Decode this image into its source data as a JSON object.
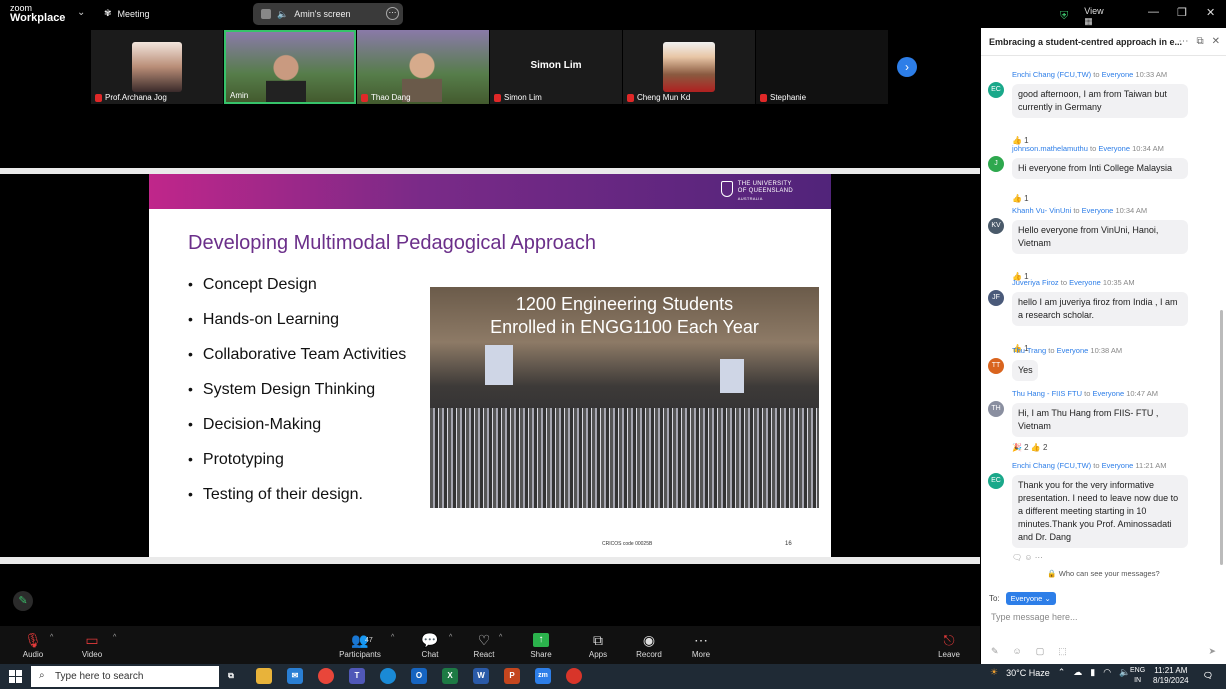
{
  "topbar": {
    "logo_line1": "zoom",
    "logo_line2": "Workplace",
    "meeting_label": "Meeting",
    "share_label": "Amin's screen",
    "view_label": "View"
  },
  "participants": [
    {
      "name": "Prof.Archana Jog",
      "type": "photo"
    },
    {
      "name": "Amin",
      "type": "video",
      "active": true
    },
    {
      "name": "Thao Dang",
      "type": "video"
    },
    {
      "name": "Simon Lim",
      "type": "name",
      "center": "Simon Lim"
    },
    {
      "name": "Cheng Mun Kd",
      "type": "photo"
    },
    {
      "name": "Stephanie",
      "type": "blank"
    }
  ],
  "slide": {
    "university": "THE UNIVERSITY OF QUEENSLAND",
    "university_line1": "THE UNIVERSITY",
    "university_line2": "OF QUEENSLAND",
    "university_line3": "AUSTRALIA",
    "title": "Developing Multimodal Pedagogical Approach",
    "bullets": [
      "Concept Design",
      "Hands-on Learning",
      "Collaborative Team Activities",
      "System Design Thinking",
      "Decision-Making",
      "Prototyping",
      "Testing of their design."
    ],
    "photo_caption_1": "1200 Engineering Students",
    "photo_caption_2": "Enrolled in ENGG1100 Each Year",
    "cricos": "CRICOS code 00025B",
    "page": "16"
  },
  "toolbar": {
    "audio": "Audio",
    "video": "Video",
    "participants": "Participants",
    "participants_count": "47",
    "chat": "Chat",
    "react": "React",
    "share": "Share",
    "apps": "Apps",
    "record": "Record",
    "more": "More",
    "leave": "Leave"
  },
  "chat": {
    "title": "Embracing a student-centred approach in e...",
    "messages": [
      {
        "from": "Enchi Chang (FCU,TW)",
        "to": "Everyone",
        "time": "10:33 AM",
        "initials": "EC",
        "color": "#1aa88a",
        "text": "good afternoon, I am from Taiwan but currently in Germany",
        "reaction": "👍 1"
      },
      {
        "from": "johnson.mathelamuthu",
        "to": "Everyone",
        "time": "10:34 AM",
        "initials": "J",
        "color": "#2ea84e",
        "text": "Hi everyone from Inti College Malaysia",
        "reaction": "👍 1"
      },
      {
        "from": "Khanh Vu- VinUni",
        "to": "Everyone",
        "time": "10:34 AM",
        "initials": "KV",
        "color": "#4a5a6a",
        "text": "Hello everyone from VinUni, Hanoi, Vietnam",
        "reaction": "👍 1"
      },
      {
        "from": "Juveriya Firoz",
        "to": "Everyone",
        "time": "10:35 AM",
        "initials": "JF",
        "color": "#4a5a7a",
        "text": "hello I am juveriya firoz from India , I am a research scholar.",
        "reaction": "👍 1"
      },
      {
        "from": "Thu Trang",
        "to": "Everyone",
        "time": "10:38 AM",
        "initials": "TT",
        "color": "#d9641e",
        "text": "Yes",
        "reaction": ""
      },
      {
        "from": "Thu Hang - FIIS FTU",
        "to": "Everyone",
        "time": "10:47 AM",
        "initials": "TH",
        "color": "#8a8fa0",
        "text": "Hi, I am Thu Hang from FIIS- FTU , Vietnam",
        "reaction": "🎉 2   👍 2"
      },
      {
        "from": "Enchi Chang (FCU,TW)",
        "to": "Everyone",
        "time": "11:21 AM",
        "initials": "EC",
        "color": "#1aa88a",
        "text": "Thank you for the very informative presentation. I need to leave now due to a different meeting starting in 10 minutes.Thank you Prof. Aminossadati and Dr. Dang",
        "reaction": ""
      }
    ],
    "to_word": "to",
    "who_can_see": "Who can see your messages?",
    "to_label": "To:",
    "to_value": "Everyone",
    "placeholder": "Type message here..."
  },
  "taskbar": {
    "search_placeholder": "Type here to search",
    "weather": "30°C  Haze",
    "lang1": "ENG",
    "lang2": "IN",
    "time": "11:21 AM",
    "date": "8/19/2024"
  }
}
